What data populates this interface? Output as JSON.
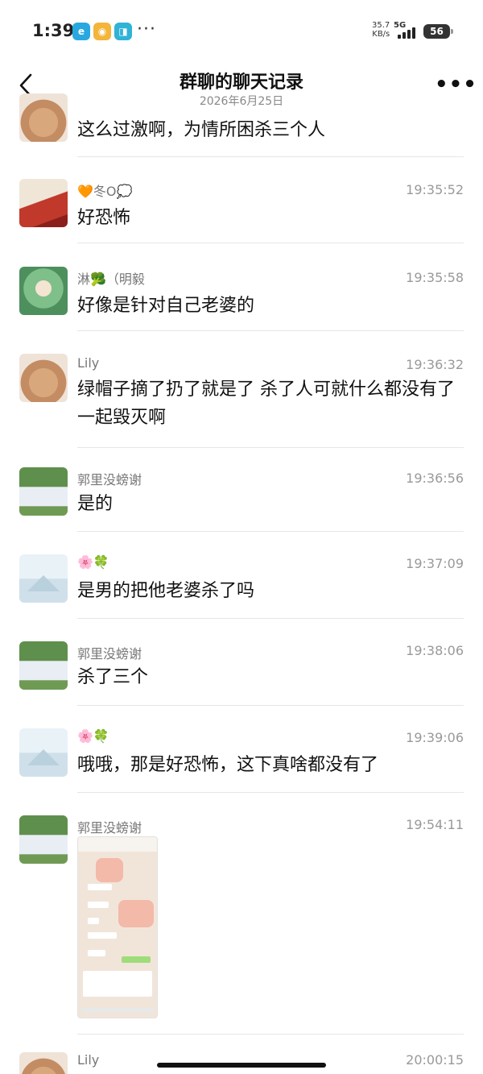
{
  "status_bar": {
    "time": "1:39",
    "net_speed": "35.7\nKB/s",
    "network": "5G",
    "battery": "56",
    "more": "···"
  },
  "header": {
    "title": "群聊的聊天记录",
    "subtitle": "2026年6月25日",
    "more": "•••"
  },
  "messages": [
    {
      "sender": "",
      "time": "",
      "text": "这么过激啊，为情所困杀三个人"
    },
    {
      "sender": "🧡冬O💭",
      "time": "19:35:52",
      "text": "好恐怖"
    },
    {
      "sender": "淋🥦（明毅",
      "time": "19:35:58",
      "text": "好像是针对自己老婆的"
    },
    {
      "sender": "Lily",
      "time": "19:36:32",
      "text": "绿帽子摘了扔了就是了 杀了人可就什么都没有了 一起毁灭啊"
    },
    {
      "sender": "郭里没螃谢",
      "time": "19:36:56",
      "text": "是的"
    },
    {
      "sender": "🌸🍀",
      "time": "19:37:09",
      "text": "是男的把他老婆杀了吗"
    },
    {
      "sender": "郭里没螃谢",
      "time": "19:38:06",
      "text": "杀了三个"
    },
    {
      "sender": "🌸🍀",
      "time": "19:39:06",
      "text": "哦哦，那是好恐怖，这下真啥都没有了"
    },
    {
      "sender": "郭里没螃谢",
      "time": "19:54:11",
      "text": ""
    },
    {
      "sender": "Lily",
      "time": "20:00:15",
      "text": ""
    }
  ]
}
